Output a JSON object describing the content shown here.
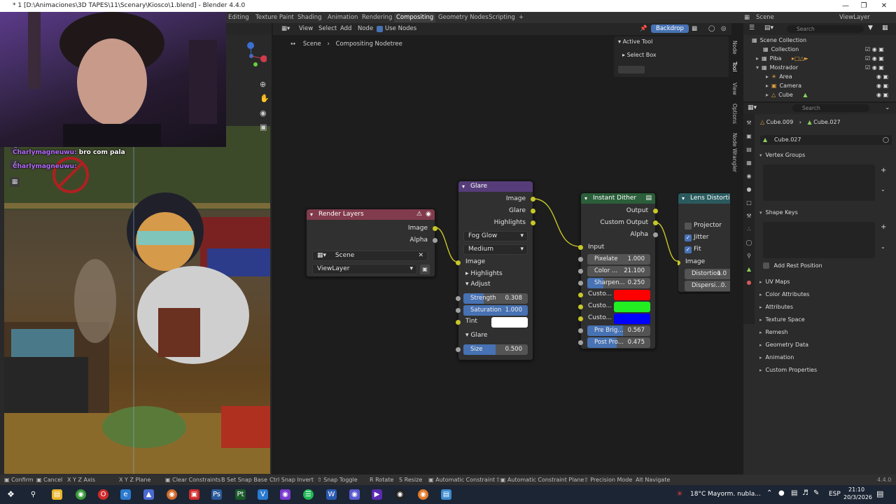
{
  "window": {
    "title": "* 1 [D:\\Animaciones\\3D TAPES\\11\\Scenary\\Kiosco\\1.blend] - Blender 4.4.0"
  },
  "workspace_tabs": [
    "Editing",
    "Texture Paint",
    "Shading",
    "Animation",
    "Rendering",
    "Compositing",
    "Geometry Nodes",
    "Scripting"
  ],
  "active_tab": "Compositing",
  "scene_selector": "Scene",
  "viewlayer_selector": "ViewLayer",
  "chat": {
    "line1_user": "Charlymagneuwu:",
    "line1_msg": "bro com pala",
    "line2_user": "Charlymagneuwu:"
  },
  "node_editor": {
    "menu": [
      "View",
      "Select",
      "Add",
      "Node"
    ],
    "use_nodes_label": "Use Nodes",
    "backdrop_label": "Backdrop",
    "breadcrumb": [
      "Scene",
      "Compositing Nodetree"
    ],
    "active_tool_title": "Active Tool",
    "active_tool_item": "Select Box",
    "side_tabs": [
      "Node",
      "Tool",
      "View",
      "Options",
      "Node Wrangler"
    ]
  },
  "nodes": {
    "render_layers": {
      "title": "Render Layers",
      "outputs": [
        "Image",
        "Alpha"
      ],
      "scene": "Scene",
      "view_layer": "ViewLayer"
    },
    "glare": {
      "title": "Glare",
      "outputs": [
        "Image",
        "Glare",
        "Highlights"
      ],
      "glare_type": "Fog Glow",
      "quality": "Medium",
      "input_image": "Image",
      "highlights_label": "Highlights",
      "adjust_label": "Adjust",
      "strength_label": "Strength",
      "strength_value": "0.308",
      "saturation_label": "Saturation",
      "saturation_value": "1.000",
      "tint_label": "Tint",
      "glare_section": "Glare",
      "size_label": "Size",
      "size_value": "0.500"
    },
    "instant_dither": {
      "title": "Instant Dither",
      "outputs": [
        "Output",
        "Custom Output",
        "Alpha"
      ],
      "input_label": "Input",
      "pixelate_label": "Pixelate",
      "pixelate_value": "1.000",
      "color_label": "Color ...",
      "color_value": "21.100",
      "sharpen_label": "Sharpen...",
      "sharpen_value": "0.250",
      "custom_labels": [
        "Custo...",
        "Custo...",
        "Custo..."
      ],
      "custom_colors": [
        "#ff0000",
        "#22ee22",
        "#0000ff"
      ],
      "prebright_label": "Pre Brig...",
      "prebright_value": "0.567",
      "postpro_label": "Post Pro...",
      "postpro_value": "0.475"
    },
    "lens_distortion": {
      "title": "Lens Distortio",
      "projector_label": "Projector",
      "jitter_label": "Jitter",
      "fit_label": "Fit",
      "image_label": "Image",
      "distortion_label": "Distortion",
      "distortion_value": "1.0",
      "dispersion_label": "Dispersi...",
      "dispersion_value": "0."
    }
  },
  "outliner": {
    "search_placeholder": "Search",
    "items": [
      {
        "label": "Scene Collection",
        "indent": 0
      },
      {
        "label": "Collection",
        "indent": 1
      },
      {
        "label": "Piba",
        "indent": 1
      },
      {
        "label": "Mostrador",
        "indent": 1
      },
      {
        "label": "Area",
        "indent": 2
      },
      {
        "label": "Camera",
        "indent": 2
      },
      {
        "label": "Cube",
        "indent": 2
      }
    ]
  },
  "properties": {
    "search_placeholder": "Search",
    "object_name": "Cube.009",
    "mesh_name": "Cube.027",
    "mesh_datablock": "Cube.027",
    "vertex_groups": "Vertex Groups",
    "shape_keys": "Shape Keys",
    "add_rest_position": "Add Rest Position",
    "panels": [
      "UV Maps",
      "Color Attributes",
      "Attributes",
      "Texture Space",
      "Remesh",
      "Geometry Data",
      "Animation",
      "Custom Properties"
    ]
  },
  "statusbar": {
    "items": [
      "Confirm",
      "Cancel",
      "X Y Z Axis",
      "X Y Z Plane",
      "Clear Constraints",
      "Set Snap Base",
      "Snap Invert",
      "Snap Toggle",
      "Rotate",
      "Resize",
      "Automatic Constraint",
      "Automatic Constraint Plane",
      "Precision Mode",
      "Navigate"
    ],
    "version": "4.4.0"
  },
  "taskbar": {
    "weather": "18°C",
    "weather_desc": "Mayorm. nubla...",
    "language": "ESP",
    "time": "21:10",
    "date": "20/3/2026"
  }
}
